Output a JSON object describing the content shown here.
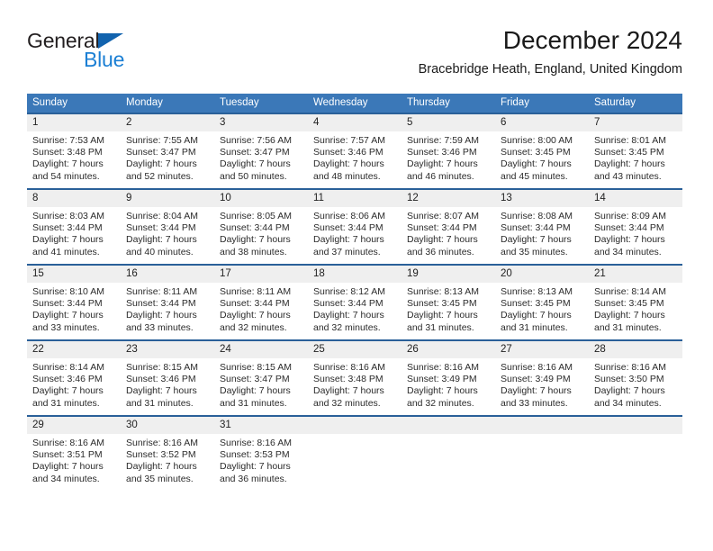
{
  "brand": {
    "name_part1": "General",
    "name_part2": "Blue",
    "accent_color": "#1b7fd4",
    "header_color": "#3b78b8"
  },
  "header": {
    "title": "December 2024",
    "subtitle": "Bracebridge Heath, England, United Kingdom"
  },
  "calendar": {
    "weekday_headers": [
      "Sunday",
      "Monday",
      "Tuesday",
      "Wednesday",
      "Thursday",
      "Friday",
      "Saturday"
    ],
    "weeks": [
      [
        {
          "day": "1",
          "sunrise": "Sunrise: 7:53 AM",
          "sunset": "Sunset: 3:48 PM",
          "daylight_line1": "Daylight: 7 hours",
          "daylight_line2": "and 54 minutes."
        },
        {
          "day": "2",
          "sunrise": "Sunrise: 7:55 AM",
          "sunset": "Sunset: 3:47 PM",
          "daylight_line1": "Daylight: 7 hours",
          "daylight_line2": "and 52 minutes."
        },
        {
          "day": "3",
          "sunrise": "Sunrise: 7:56 AM",
          "sunset": "Sunset: 3:47 PM",
          "daylight_line1": "Daylight: 7 hours",
          "daylight_line2": "and 50 minutes."
        },
        {
          "day": "4",
          "sunrise": "Sunrise: 7:57 AM",
          "sunset": "Sunset: 3:46 PM",
          "daylight_line1": "Daylight: 7 hours",
          "daylight_line2": "and 48 minutes."
        },
        {
          "day": "5",
          "sunrise": "Sunrise: 7:59 AM",
          "sunset": "Sunset: 3:46 PM",
          "daylight_line1": "Daylight: 7 hours",
          "daylight_line2": "and 46 minutes."
        },
        {
          "day": "6",
          "sunrise": "Sunrise: 8:00 AM",
          "sunset": "Sunset: 3:45 PM",
          "daylight_line1": "Daylight: 7 hours",
          "daylight_line2": "and 45 minutes."
        },
        {
          "day": "7",
          "sunrise": "Sunrise: 8:01 AM",
          "sunset": "Sunset: 3:45 PM",
          "daylight_line1": "Daylight: 7 hours",
          "daylight_line2": "and 43 minutes."
        }
      ],
      [
        {
          "day": "8",
          "sunrise": "Sunrise: 8:03 AM",
          "sunset": "Sunset: 3:44 PM",
          "daylight_line1": "Daylight: 7 hours",
          "daylight_line2": "and 41 minutes."
        },
        {
          "day": "9",
          "sunrise": "Sunrise: 8:04 AM",
          "sunset": "Sunset: 3:44 PM",
          "daylight_line1": "Daylight: 7 hours",
          "daylight_line2": "and 40 minutes."
        },
        {
          "day": "10",
          "sunrise": "Sunrise: 8:05 AM",
          "sunset": "Sunset: 3:44 PM",
          "daylight_line1": "Daylight: 7 hours",
          "daylight_line2": "and 38 minutes."
        },
        {
          "day": "11",
          "sunrise": "Sunrise: 8:06 AM",
          "sunset": "Sunset: 3:44 PM",
          "daylight_line1": "Daylight: 7 hours",
          "daylight_line2": "and 37 minutes."
        },
        {
          "day": "12",
          "sunrise": "Sunrise: 8:07 AM",
          "sunset": "Sunset: 3:44 PM",
          "daylight_line1": "Daylight: 7 hours",
          "daylight_line2": "and 36 minutes."
        },
        {
          "day": "13",
          "sunrise": "Sunrise: 8:08 AM",
          "sunset": "Sunset: 3:44 PM",
          "daylight_line1": "Daylight: 7 hours",
          "daylight_line2": "and 35 minutes."
        },
        {
          "day": "14",
          "sunrise": "Sunrise: 8:09 AM",
          "sunset": "Sunset: 3:44 PM",
          "daylight_line1": "Daylight: 7 hours",
          "daylight_line2": "and 34 minutes."
        }
      ],
      [
        {
          "day": "15",
          "sunrise": "Sunrise: 8:10 AM",
          "sunset": "Sunset: 3:44 PM",
          "daylight_line1": "Daylight: 7 hours",
          "daylight_line2": "and 33 minutes."
        },
        {
          "day": "16",
          "sunrise": "Sunrise: 8:11 AM",
          "sunset": "Sunset: 3:44 PM",
          "daylight_line1": "Daylight: 7 hours",
          "daylight_line2": "and 33 minutes."
        },
        {
          "day": "17",
          "sunrise": "Sunrise: 8:11 AM",
          "sunset": "Sunset: 3:44 PM",
          "daylight_line1": "Daylight: 7 hours",
          "daylight_line2": "and 32 minutes."
        },
        {
          "day": "18",
          "sunrise": "Sunrise: 8:12 AM",
          "sunset": "Sunset: 3:44 PM",
          "daylight_line1": "Daylight: 7 hours",
          "daylight_line2": "and 32 minutes."
        },
        {
          "day": "19",
          "sunrise": "Sunrise: 8:13 AM",
          "sunset": "Sunset: 3:45 PM",
          "daylight_line1": "Daylight: 7 hours",
          "daylight_line2": "and 31 minutes."
        },
        {
          "day": "20",
          "sunrise": "Sunrise: 8:13 AM",
          "sunset": "Sunset: 3:45 PM",
          "daylight_line1": "Daylight: 7 hours",
          "daylight_line2": "and 31 minutes."
        },
        {
          "day": "21",
          "sunrise": "Sunrise: 8:14 AM",
          "sunset": "Sunset: 3:45 PM",
          "daylight_line1": "Daylight: 7 hours",
          "daylight_line2": "and 31 minutes."
        }
      ],
      [
        {
          "day": "22",
          "sunrise": "Sunrise: 8:14 AM",
          "sunset": "Sunset: 3:46 PM",
          "daylight_line1": "Daylight: 7 hours",
          "daylight_line2": "and 31 minutes."
        },
        {
          "day": "23",
          "sunrise": "Sunrise: 8:15 AM",
          "sunset": "Sunset: 3:46 PM",
          "daylight_line1": "Daylight: 7 hours",
          "daylight_line2": "and 31 minutes."
        },
        {
          "day": "24",
          "sunrise": "Sunrise: 8:15 AM",
          "sunset": "Sunset: 3:47 PM",
          "daylight_line1": "Daylight: 7 hours",
          "daylight_line2": "and 31 minutes."
        },
        {
          "day": "25",
          "sunrise": "Sunrise: 8:16 AM",
          "sunset": "Sunset: 3:48 PM",
          "daylight_line1": "Daylight: 7 hours",
          "daylight_line2": "and 32 minutes."
        },
        {
          "day": "26",
          "sunrise": "Sunrise: 8:16 AM",
          "sunset": "Sunset: 3:49 PM",
          "daylight_line1": "Daylight: 7 hours",
          "daylight_line2": "and 32 minutes."
        },
        {
          "day": "27",
          "sunrise": "Sunrise: 8:16 AM",
          "sunset": "Sunset: 3:49 PM",
          "daylight_line1": "Daylight: 7 hours",
          "daylight_line2": "and 33 minutes."
        },
        {
          "day": "28",
          "sunrise": "Sunrise: 8:16 AM",
          "sunset": "Sunset: 3:50 PM",
          "daylight_line1": "Daylight: 7 hours",
          "daylight_line2": "and 34 minutes."
        }
      ],
      [
        {
          "day": "29",
          "sunrise": "Sunrise: 8:16 AM",
          "sunset": "Sunset: 3:51 PM",
          "daylight_line1": "Daylight: 7 hours",
          "daylight_line2": "and 34 minutes."
        },
        {
          "day": "30",
          "sunrise": "Sunrise: 8:16 AM",
          "sunset": "Sunset: 3:52 PM",
          "daylight_line1": "Daylight: 7 hours",
          "daylight_line2": "and 35 minutes."
        },
        {
          "day": "31",
          "sunrise": "Sunrise: 8:16 AM",
          "sunset": "Sunset: 3:53 PM",
          "daylight_line1": "Daylight: 7 hours",
          "daylight_line2": "and 36 minutes."
        },
        {
          "day": "",
          "sunrise": "",
          "sunset": "",
          "daylight_line1": "",
          "daylight_line2": ""
        },
        {
          "day": "",
          "sunrise": "",
          "sunset": "",
          "daylight_line1": "",
          "daylight_line2": ""
        },
        {
          "day": "",
          "sunrise": "",
          "sunset": "",
          "daylight_line1": "",
          "daylight_line2": ""
        },
        {
          "day": "",
          "sunrise": "",
          "sunset": "",
          "daylight_line1": "",
          "daylight_line2": ""
        }
      ]
    ]
  }
}
